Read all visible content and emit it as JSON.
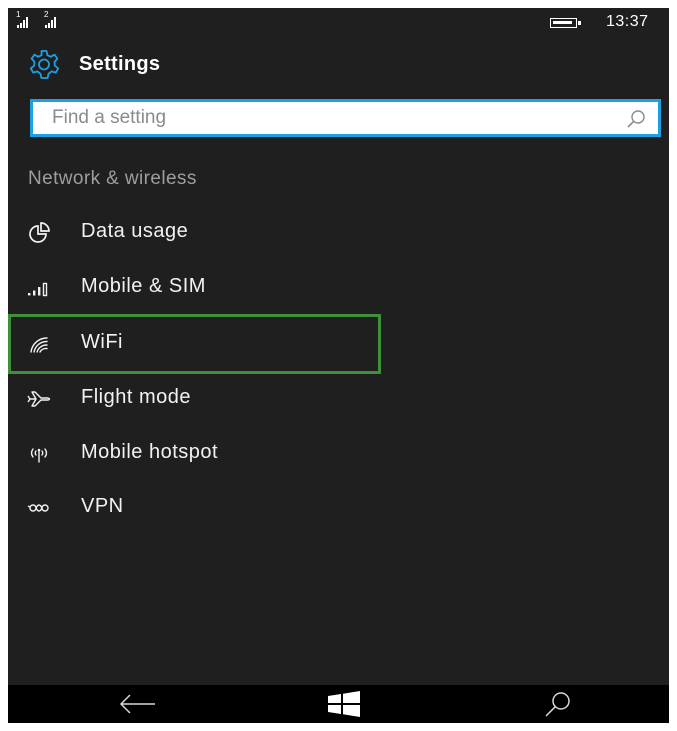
{
  "status_bar": {
    "sim1_label": "1",
    "sim2_label": "2",
    "time": "13:37",
    "icons": [
      "signal-sim1-icon",
      "signal-sim2-icon",
      "battery-icon"
    ]
  },
  "header": {
    "title": "Settings",
    "icon": "gear-icon"
  },
  "search": {
    "placeholder": "Find a setting",
    "value": "",
    "icon": "search-icon"
  },
  "section": {
    "title": "Network & wireless"
  },
  "menu_items": [
    {
      "label": "Data usage",
      "icon": "pie-chart-icon"
    },
    {
      "label": "Mobile & SIM",
      "icon": "cellular-signal-icon"
    },
    {
      "label": "WiFi",
      "icon": "wifi-icon",
      "highlighted": true
    },
    {
      "label": "Flight mode",
      "icon": "airplane-icon"
    },
    {
      "label": "Mobile hotspot",
      "icon": "hotspot-icon"
    },
    {
      "label": "VPN",
      "icon": "vpn-icon"
    }
  ],
  "nav_bar": {
    "buttons": [
      "back-arrow-icon",
      "windows-logo-icon",
      "search-icon"
    ]
  },
  "colors": {
    "background": "#1f1f1f",
    "accent": "#1ba1e2",
    "highlight_border": "#3f8f3a",
    "nav_background": "#000000"
  }
}
